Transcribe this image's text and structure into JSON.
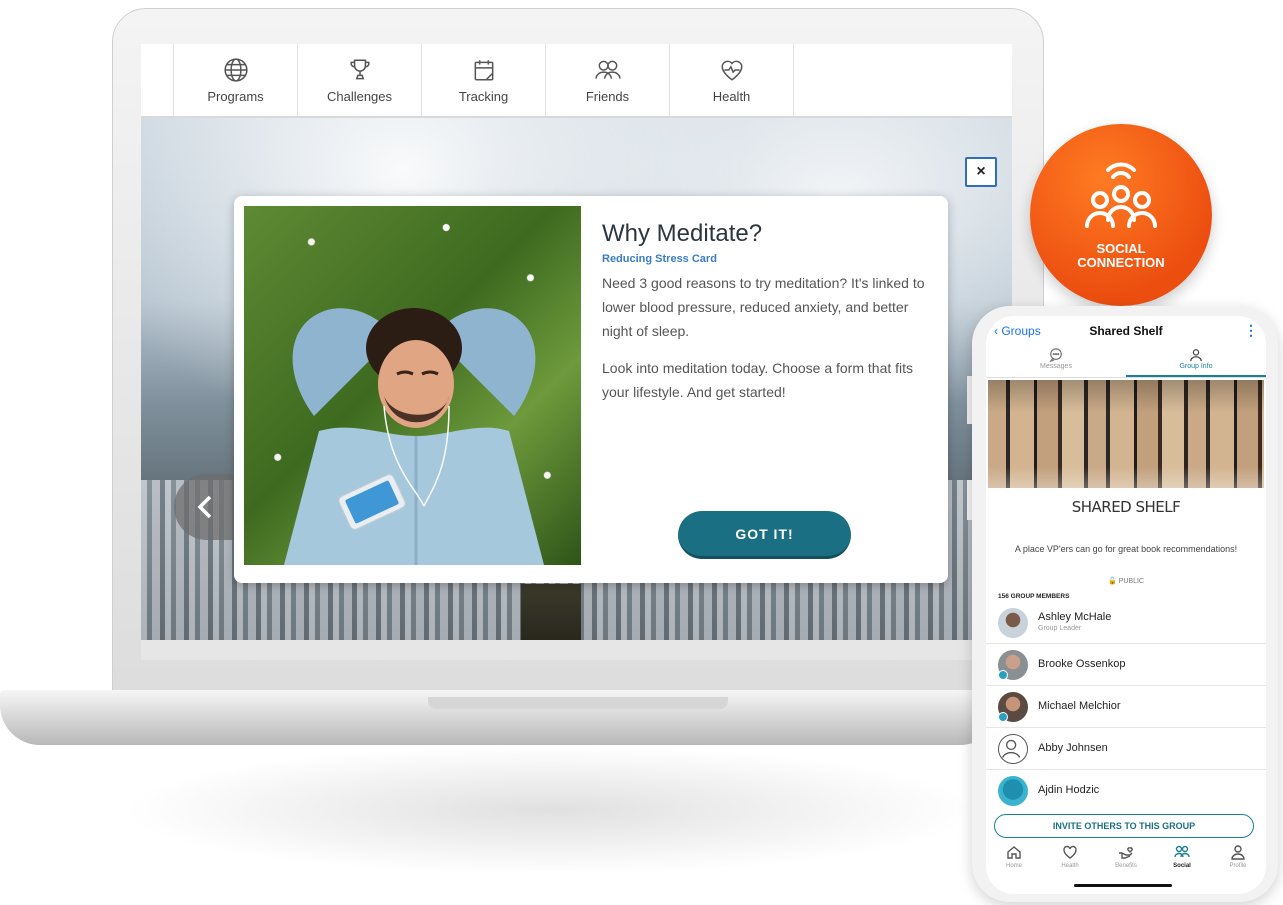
{
  "nav": {
    "items": [
      {
        "label": "Programs",
        "icon": "globe-icon"
      },
      {
        "label": "Challenges",
        "icon": "trophy-icon"
      },
      {
        "label": "Tracking",
        "icon": "calendar-icon"
      },
      {
        "label": "Friends",
        "icon": "friends-icon"
      },
      {
        "label": "Health",
        "icon": "heart-pulse-icon"
      }
    ]
  },
  "modal": {
    "title": "Why Meditate?",
    "subtitle": "Reducing Stress Card",
    "paragraph1": "Need 3 good reasons to try meditation? It's linked to lower blood pressure, reduced anxiety, and better night of sleep.",
    "paragraph2": "Look into meditation today. Choose a form that fits your lifestyle. And get started!",
    "button_label": "GOT IT!",
    "close_symbol": "×"
  },
  "badge": {
    "line1": "SOCIAL",
    "line2": "CONNECTION"
  },
  "phone": {
    "back_label": "Groups",
    "title": "Shared Shelf",
    "more_symbol": "⋮",
    "tabs": [
      {
        "label": "Messages",
        "active": false
      },
      {
        "label": "Group Info",
        "active": true
      }
    ],
    "group_name": "SHARED SHELF",
    "description": "A place VP'ers can go for great book recommendations!",
    "privacy": "PUBLIC",
    "member_count": "156 GROUP MEMBERS",
    "members": [
      {
        "name": "Ashley McHale",
        "role": "Group Leader"
      },
      {
        "name": "Brooke Ossenkop",
        "role": ""
      },
      {
        "name": "Michael Melchior",
        "role": ""
      },
      {
        "name": "Abby Johnsen",
        "role": ""
      },
      {
        "name": "Ajdin Hodzic",
        "role": ""
      }
    ],
    "invite_label": "INVITE OTHERS TO THIS GROUP",
    "bottom_nav": [
      {
        "label": "Home",
        "active": false
      },
      {
        "label": "Health",
        "active": false
      },
      {
        "label": "Benefits",
        "active": false
      },
      {
        "label": "Social",
        "active": true
      },
      {
        "label": "Profile",
        "active": false
      }
    ]
  },
  "colors": {
    "accent": "#1b6f82",
    "badge": "#ec4e10",
    "link": "#1a73e8",
    "subtitle": "#3b7dc4"
  }
}
